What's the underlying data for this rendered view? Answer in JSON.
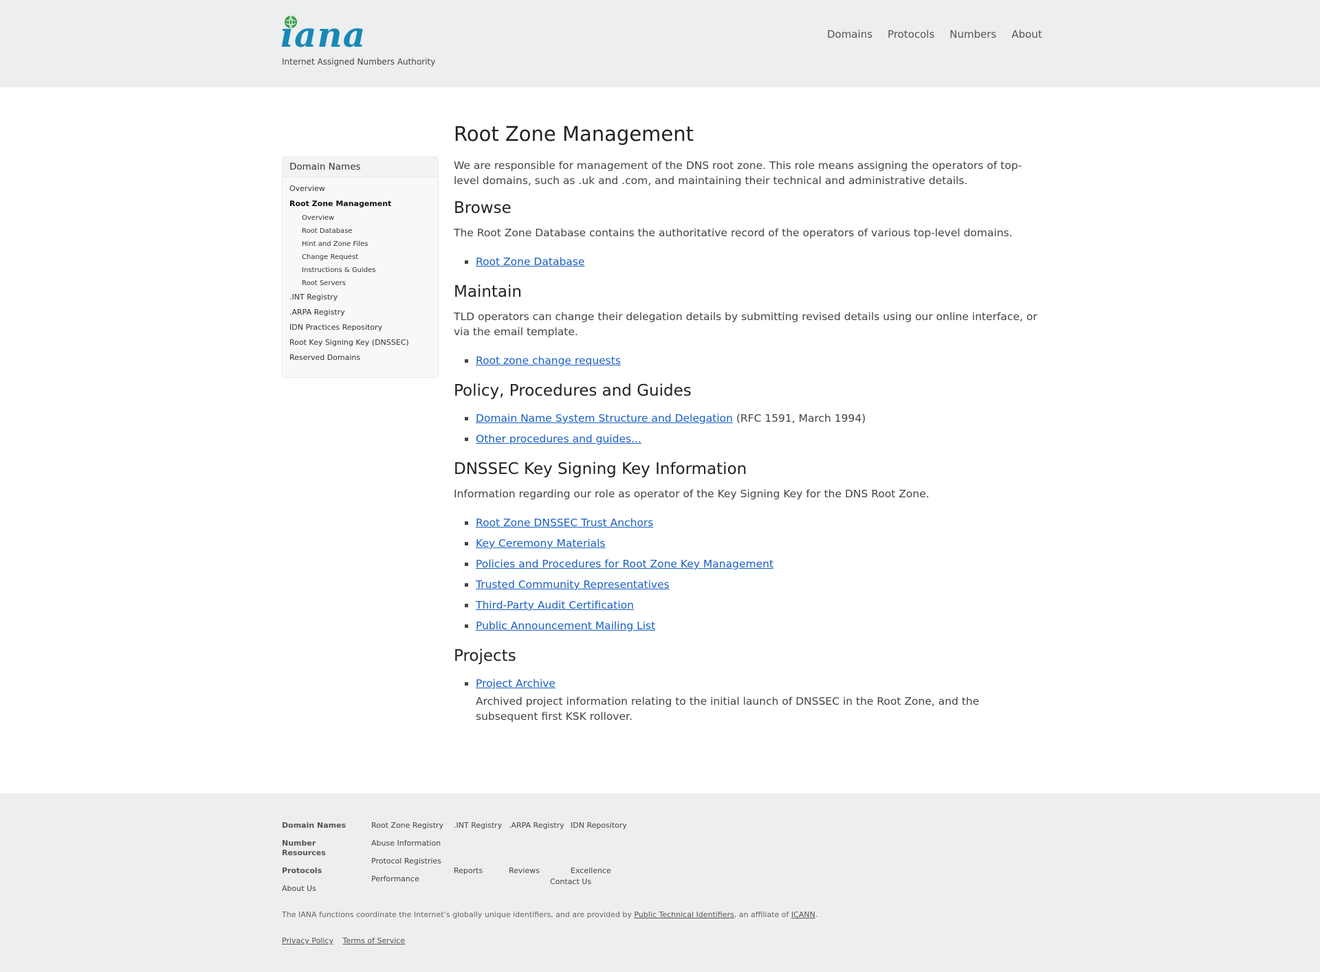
{
  "header": {
    "logo_text": "iana",
    "tagline": "Internet Assigned Numbers Authority",
    "nav": [
      {
        "label": "Domains"
      },
      {
        "label": "Protocols"
      },
      {
        "label": "Numbers"
      },
      {
        "label": "About"
      }
    ]
  },
  "sidebar": {
    "title": "Domain Names",
    "items": [
      {
        "label": "Overview"
      },
      {
        "label": "Root Zone Management"
      }
    ],
    "sub_items": [
      {
        "label": "Overview"
      },
      {
        "label": "Root Database"
      },
      {
        "label": "Hint and Zone Files"
      },
      {
        "label": "Change Request"
      },
      {
        "label": "Instructions & Guides"
      },
      {
        "label": "Root Servers"
      }
    ],
    "items_after": [
      {
        "label": ".INT Registry"
      },
      {
        "label": ".ARPA Registry"
      },
      {
        "label": "IDN Practices Repository"
      },
      {
        "label": "Root Key Signing Key (DNSSEC)"
      },
      {
        "label": "Reserved Domains"
      }
    ]
  },
  "main": {
    "title": "Root Zone Management",
    "intro": "We are responsible for management of the DNS root zone. This role means assigning the operators of top-level domains, such as .uk and .com, and maintaining their technical and administrative details.",
    "browse": {
      "heading": "Browse",
      "text": "The Root Zone Database contains the authoritative record of the operators of various top-level domains.",
      "link": "Root Zone Database"
    },
    "maintain": {
      "heading": "Maintain",
      "text": "TLD operators can change their delegation details by submitting revised details using our online interface, or via the email template.",
      "link": "Root zone change requests"
    },
    "policy": {
      "heading": "Policy, Procedures and Guides",
      "link1": "Domain Name System Structure and Delegation",
      "link1_suffix": " (RFC 1591, March 1994)",
      "link2": "Other procedures and guides..."
    },
    "dnssec": {
      "heading": "DNSSEC Key Signing Key Information",
      "text": "Information regarding our role as operator of the Key Signing Key for the DNS Root Zone.",
      "links": [
        "Root Zone DNSSEC Trust Anchors",
        "Key Ceremony Materials",
        "Policies and Procedures for Root Zone Key Management",
        "Trusted Community Representatives",
        "Third-Party Audit Certification",
        "Public Announcement Mailing List"
      ]
    },
    "projects": {
      "heading": "Projects",
      "link": "Project Archive",
      "desc": "Archived project information relating to the initial launch of DNSSEC in the Root Zone, and the subsequent first KSK rollover."
    }
  },
  "footer": {
    "col1": [
      {
        "h": "Domain Names",
        "links": []
      },
      {
        "h": "Number Resources",
        "links": []
      },
      {
        "h": "Protocols",
        "links": []
      },
      {
        "h": "",
        "links": [
          "About Us"
        ]
      }
    ],
    "col2": [
      {
        "links": [
          "Root Zone Registry"
        ]
      },
      {
        "links": [
          "Abuse Information"
        ]
      },
      {
        "links": [
          "Protocol Registries"
        ]
      },
      {
        "links": [
          "Performance"
        ]
      }
    ],
    "col3": [
      {
        "links": [
          ".INT Registry"
        ]
      },
      {
        "links": [
          "Reports"
        ]
      }
    ],
    "col4": [
      {
        "links": [
          ".ARPA Registry"
        ]
      },
      {
        "links": [
          "Reviews"
        ]
      }
    ],
    "col5": [
      {
        "links": [
          "IDN Repository"
        ]
      },
      {
        "links": [
          "Excellence"
        ]
      }
    ],
    "col6": [
      {
        "links": [
          "Contact Us"
        ]
      }
    ],
    "note_prefix": "The IANA functions coordinate the Internet’s globally unique identifiers, and are provided by ",
    "note_link": "Public Technical Identifiers",
    "note_mid": ", an affiliate of ",
    "note_link2": "ICANN",
    "note_suffix": ".",
    "legal": [
      "Privacy Policy",
      "Terms of Service"
    ]
  }
}
